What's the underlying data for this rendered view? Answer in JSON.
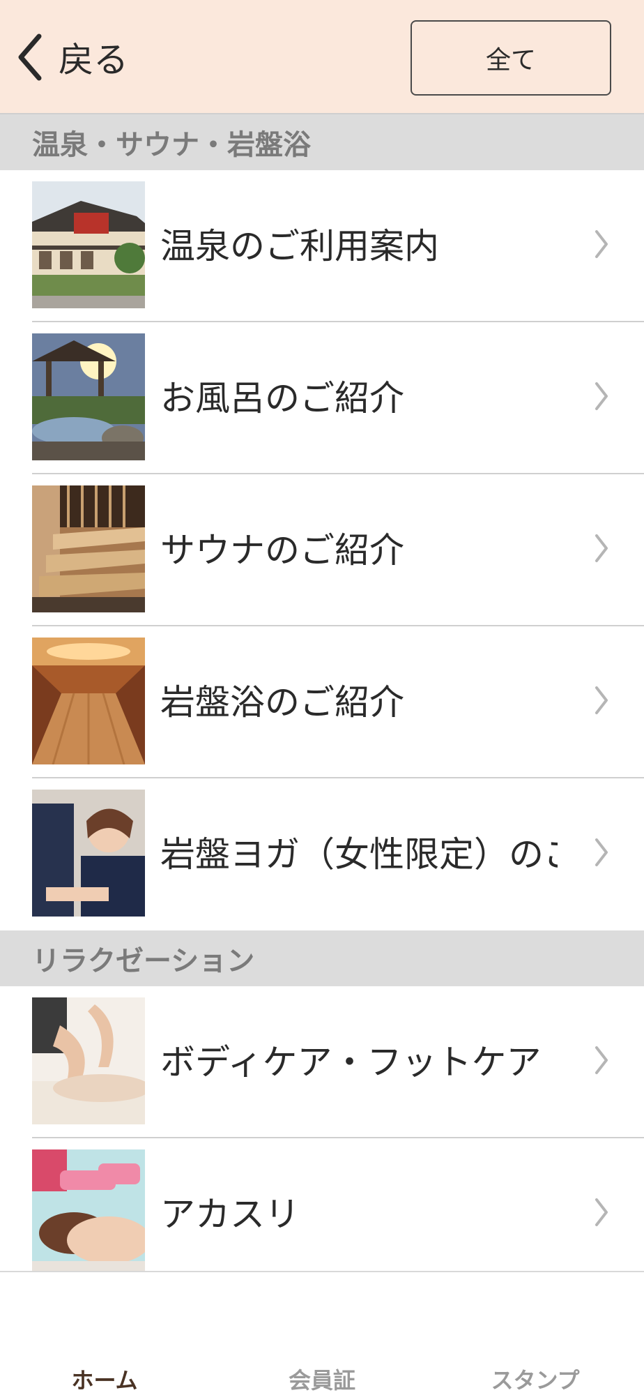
{
  "header": {
    "back_label": "戻る",
    "all_label": "全て"
  },
  "sections": [
    {
      "title": "温泉・サウナ・岩盤浴"
    },
    {
      "title": "リラクゼーション"
    }
  ],
  "items": [
    {
      "label": "温泉のご利用案内"
    },
    {
      "label": "お風呂のご紹介"
    },
    {
      "label": "サウナのご紹介"
    },
    {
      "label": "岩盤浴のご紹介"
    },
    {
      "label": "岩盤ヨガ（女性限定）のご…"
    },
    {
      "label": "ボディケア・フットケア"
    },
    {
      "label": "アカスリ"
    }
  ],
  "tabs": [
    {
      "label": "ホーム",
      "active": true
    },
    {
      "label": "会員証",
      "active": false
    },
    {
      "label": "スタンプ",
      "active": false
    }
  ],
  "colors": {
    "header_bg": "#fbe8dc",
    "section_bg": "#dcdcdc",
    "active_tab": "#4a3324",
    "inactive_tab": "#9a9a9a"
  }
}
